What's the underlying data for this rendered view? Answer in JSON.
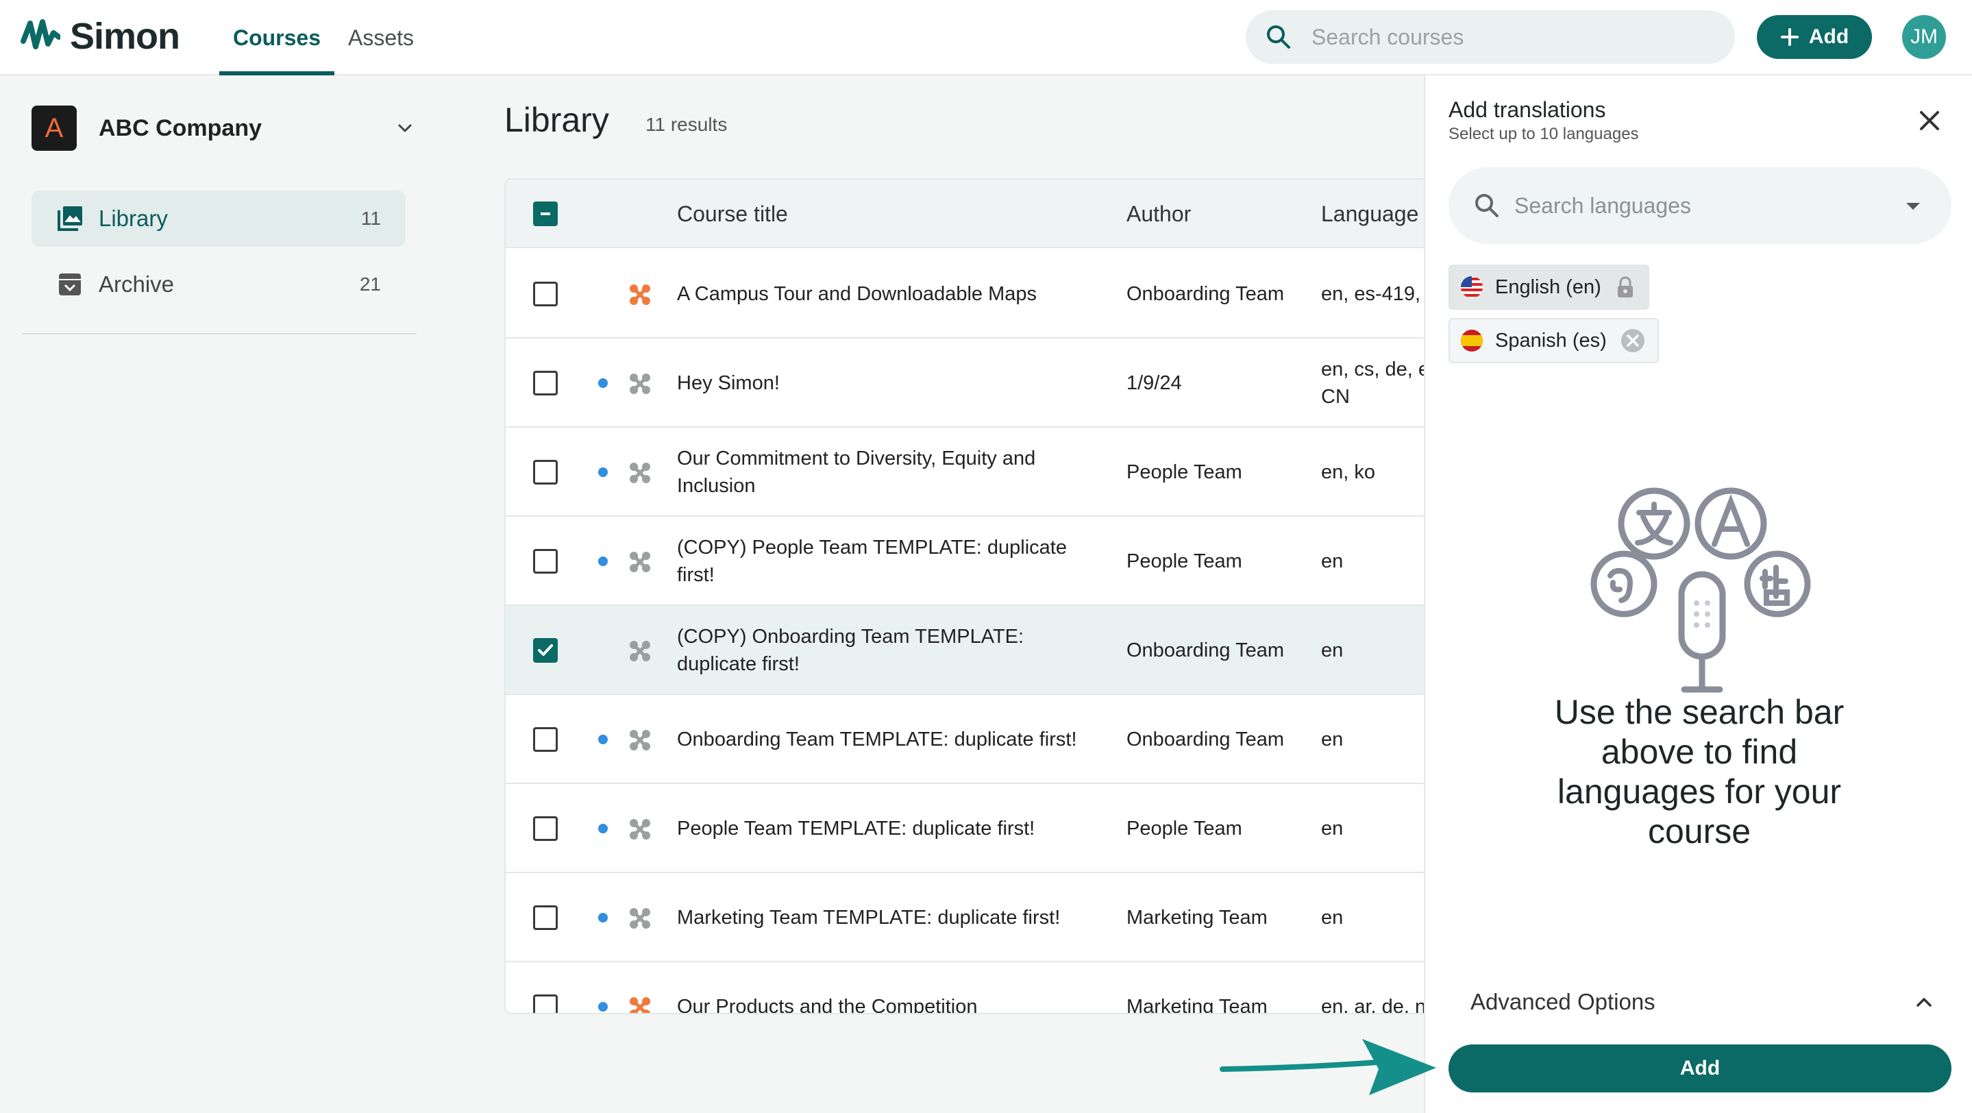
{
  "app": {
    "brand": "Simon",
    "nav": [
      {
        "label": "Courses",
        "active": true
      },
      {
        "label": "Assets",
        "active": false
      }
    ],
    "search_placeholder": "Search courses",
    "add_label": "Add",
    "avatar_initials": "JM",
    "accent_color": "#0b6a66"
  },
  "sidebar": {
    "org_initial": "A",
    "org_name": "ABC Company",
    "items": [
      {
        "label": "Library",
        "count": "11",
        "icon": "library-icon",
        "active": true
      },
      {
        "label": "Archive",
        "count": "21",
        "icon": "archive-icon",
        "active": false
      }
    ]
  },
  "library": {
    "title": "Library",
    "results": "11 results",
    "columns": [
      "Course title",
      "Author",
      "Language"
    ],
    "rows": [
      {
        "title": "A Campus Tour and Downloadable Maps",
        "author": "Onboarding Team",
        "language": "en, es-419,",
        "checked": false,
        "dot": false,
        "icon_color": "#f07a3c"
      },
      {
        "title": "Hey Simon!",
        "author": "1/9/24",
        "language": "en, cs, de, e CN",
        "checked": false,
        "dot": true,
        "icon_color": "#9aa0a0"
      },
      {
        "title": "Our Commitment to Diversity, Equity and Inclusion",
        "author": "People Team",
        "language": "en, ko",
        "checked": false,
        "dot": true,
        "icon_color": "#9aa0a0"
      },
      {
        "title": "(COPY) People Team TEMPLATE: duplicate first!",
        "author": "People Team",
        "language": "en",
        "checked": false,
        "dot": true,
        "icon_color": "#9aa0a0"
      },
      {
        "title": "(COPY) Onboarding Team TEMPLATE: duplicate first!",
        "author": "Onboarding Team",
        "language": "en",
        "checked": true,
        "dot": false,
        "icon_color": "#9aa0a0"
      },
      {
        "title": "Onboarding Team TEMPLATE: duplicate first!",
        "author": "Onboarding Team",
        "language": "en",
        "checked": false,
        "dot": true,
        "icon_color": "#9aa0a0"
      },
      {
        "title": "People Team TEMPLATE: duplicate first!",
        "author": "People Team",
        "language": "en",
        "checked": false,
        "dot": true,
        "icon_color": "#9aa0a0"
      },
      {
        "title": "Marketing Team TEMPLATE: duplicate first!",
        "author": "Marketing Team",
        "language": "en",
        "checked": false,
        "dot": true,
        "icon_color": "#9aa0a0"
      },
      {
        "title": "Our Products and the Competition",
        "author": "Marketing Team",
        "language": "en, ar, de, n",
        "checked": false,
        "dot": true,
        "icon_color": "#f07a3c"
      }
    ]
  },
  "panel": {
    "title": "Add translations",
    "subtitle": "Select up to 10 languages",
    "search_placeholder": "Search languages",
    "chips": [
      {
        "label": "English (en)",
        "flag": "us-flag-icon",
        "trail": "lock-icon"
      },
      {
        "label": "Spanish (es)",
        "flag": "spain-flag-icon",
        "trail": "remove-icon"
      }
    ],
    "empty_message": "Use the search bar above to find languages for your course",
    "advanced_label": "Advanced Options",
    "add_label": "Add"
  }
}
